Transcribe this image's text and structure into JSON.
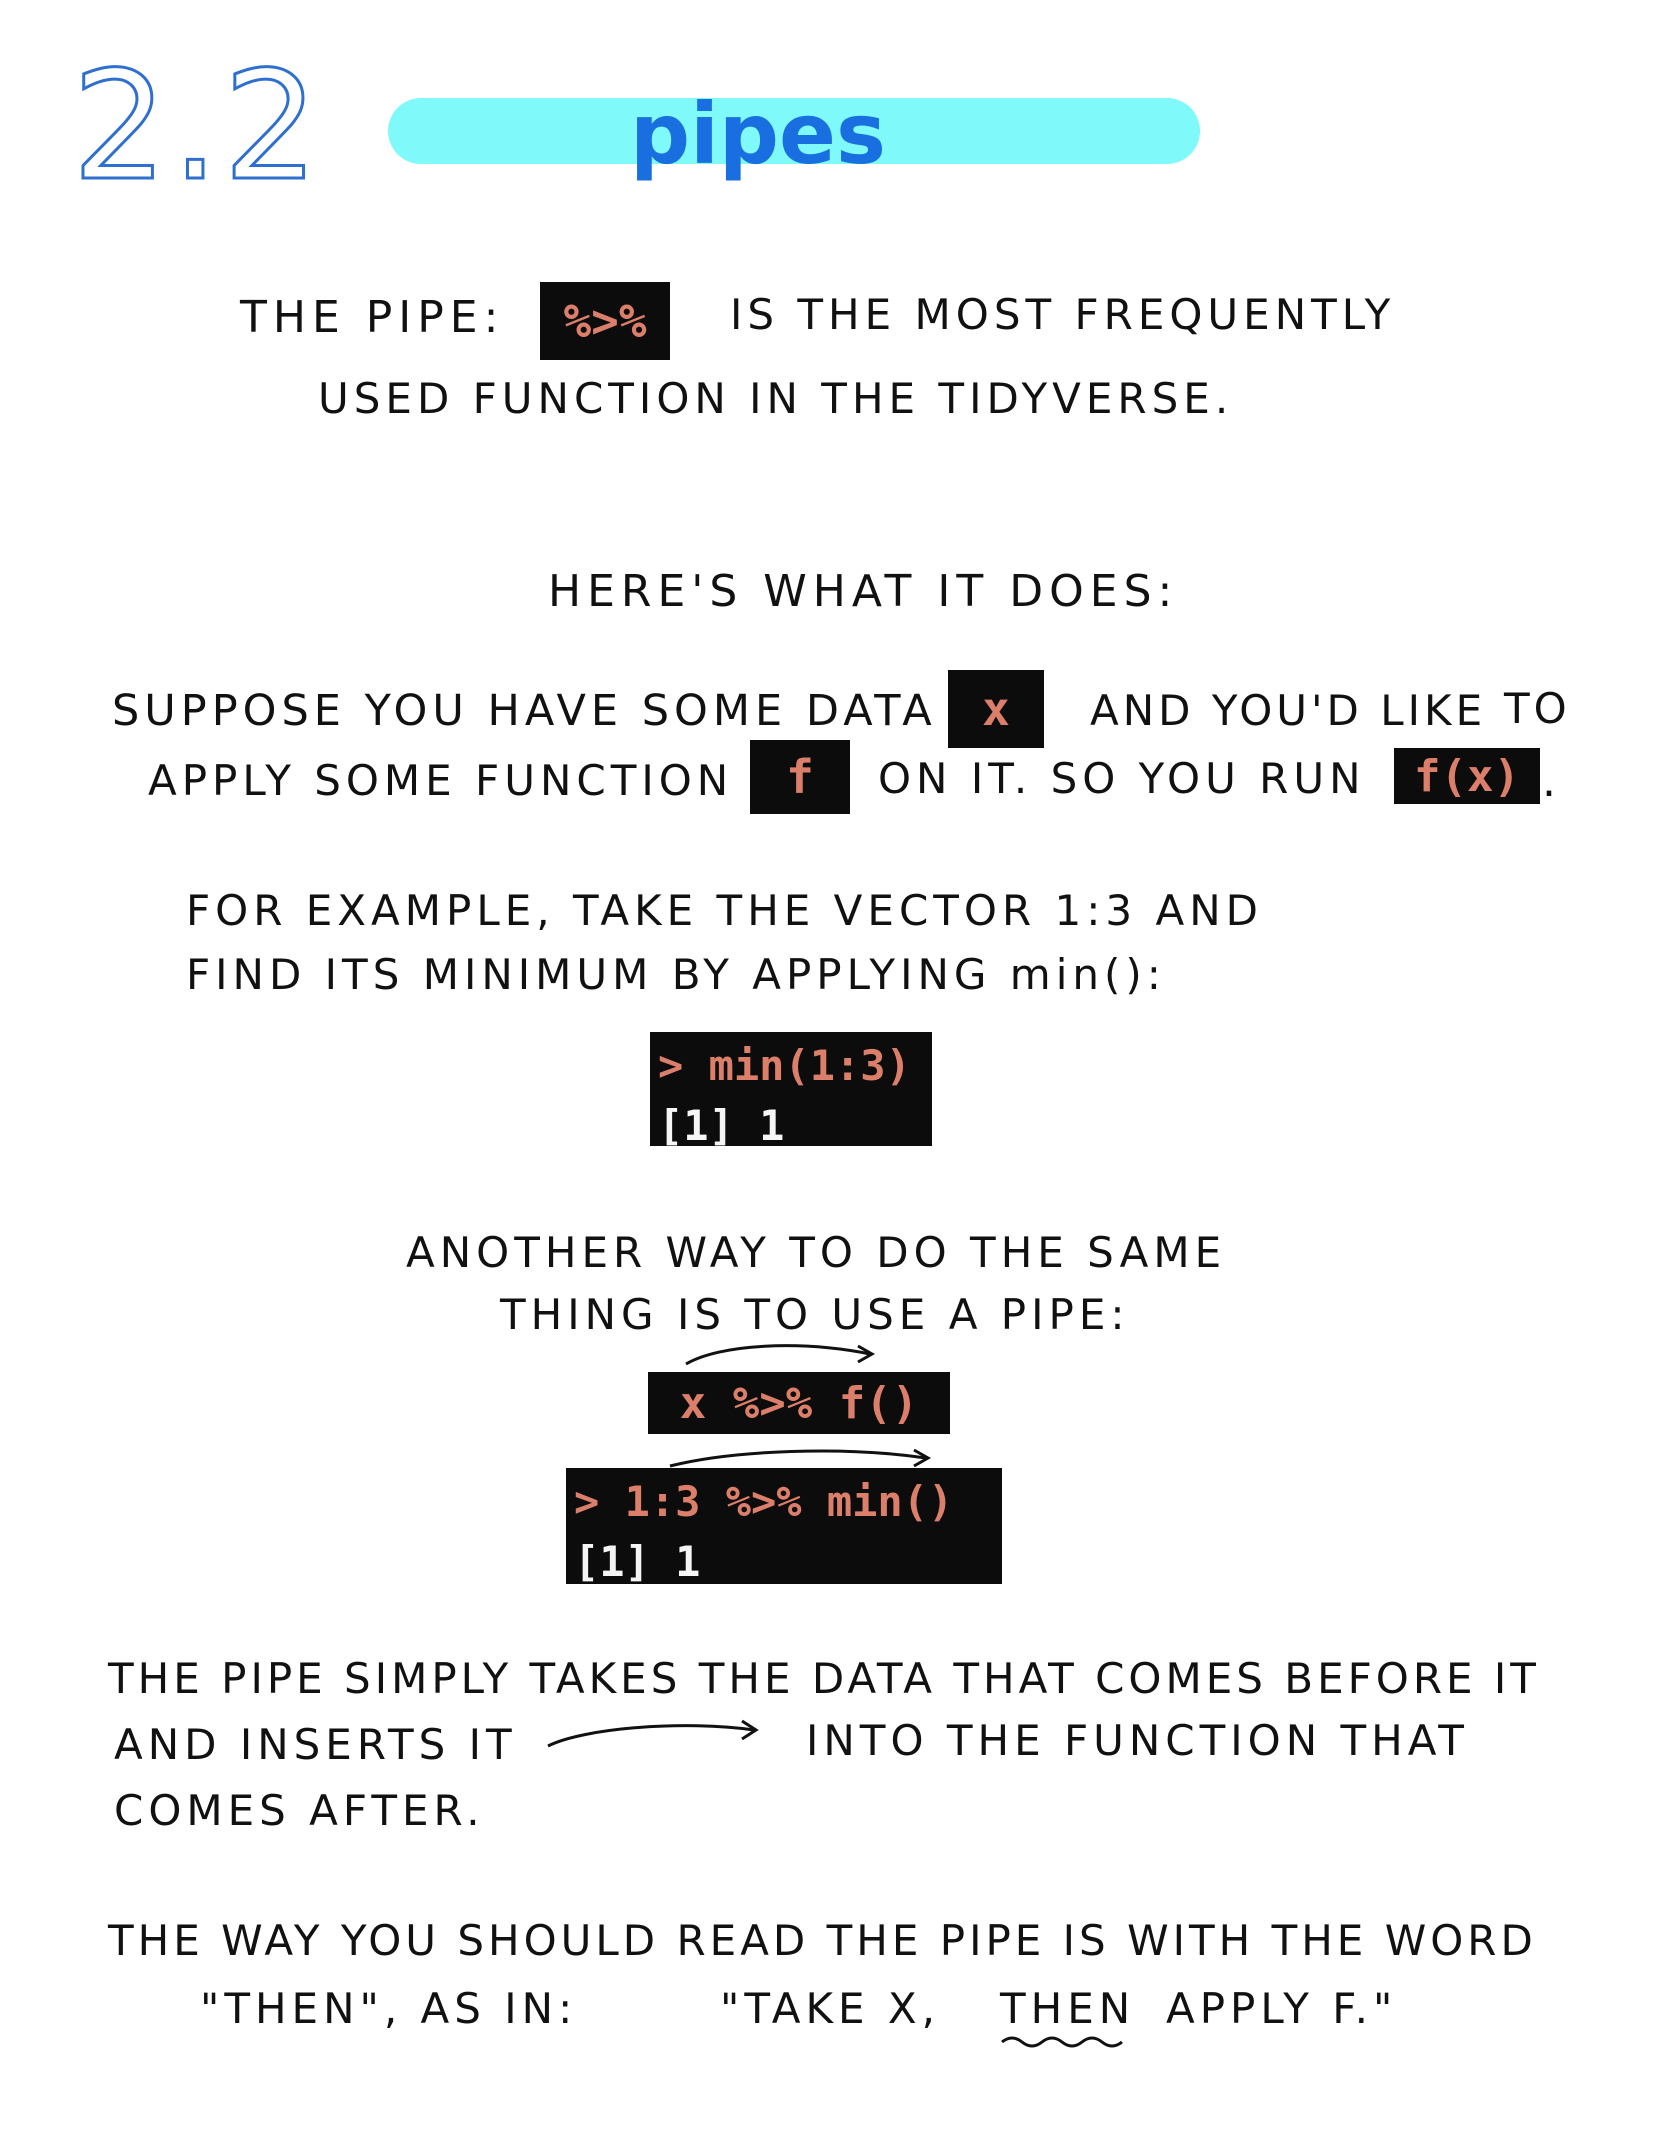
{
  "header": {
    "section_number": "2.2",
    "title": "pipes"
  },
  "intro": {
    "line1_a": "THE  PIPE:",
    "pipe_operator": "%>%",
    "line1_b": "IS  THE  MOST  FREQUENTLY",
    "line2": "USED  FUNCTION  IN  THE  TIDYVERSE."
  },
  "what_it_does": "HERE'S WHAT  IT  DOES:",
  "suppose": {
    "line1_a": "SUPPOSE  YOU  HAVE  SOME  DATA",
    "data_var": "x",
    "line1_b": "AND  YOU'D  LIKE",
    "line1_c": "TO",
    "line2_a": "APPLY  SOME  FUNCTION",
    "func_var": "f",
    "line2_b": "ON  IT.  SO  YOU  RUN",
    "call": "f(x)",
    "period": "."
  },
  "example": {
    "line1": "FOR  EXAMPLE,  TAKE  THE  VECTOR  1:3  AND",
    "line2": "FIND  ITS  MINIMUM  BY  APPLYING  min():",
    "console_input": "> min(1:3)",
    "console_output": "[1] 1"
  },
  "another_way": {
    "line1": "ANOTHER WAY  TO  DO  THE  SAME",
    "line2": "THING  IS  TO  USE  A PIPE:",
    "pipe_template": "x %>% f()",
    "console_input": "> 1:3 %>% min()",
    "console_output": "[1] 1"
  },
  "explanation": {
    "line1": "THE  PIPE  SIMPLY  TAKES  THE  DATA  THAT  COMES  BEFORE  IT",
    "line2_a": "AND  INSERTS  IT",
    "line2_b": "INTO  THE  FUNCTION  THAT",
    "line3": "COMES  AFTER."
  },
  "reading": {
    "line1": "THE  WAY  YOU  SHOULD  READ THE  PIPE  IS  WITH  THE  WORD",
    "line2_a": "\"THEN\",  AS  IN:",
    "line2_b": "\"TAKE  X,",
    "line2_then": "THEN",
    "line2_c": "APPLY  F.\""
  },
  "colors": {
    "title_blue": "#1a6fe0",
    "pill_cyan": "#7ff9fa",
    "code_bg": "#0c0c0c",
    "code_text": "#dc7f6a"
  }
}
